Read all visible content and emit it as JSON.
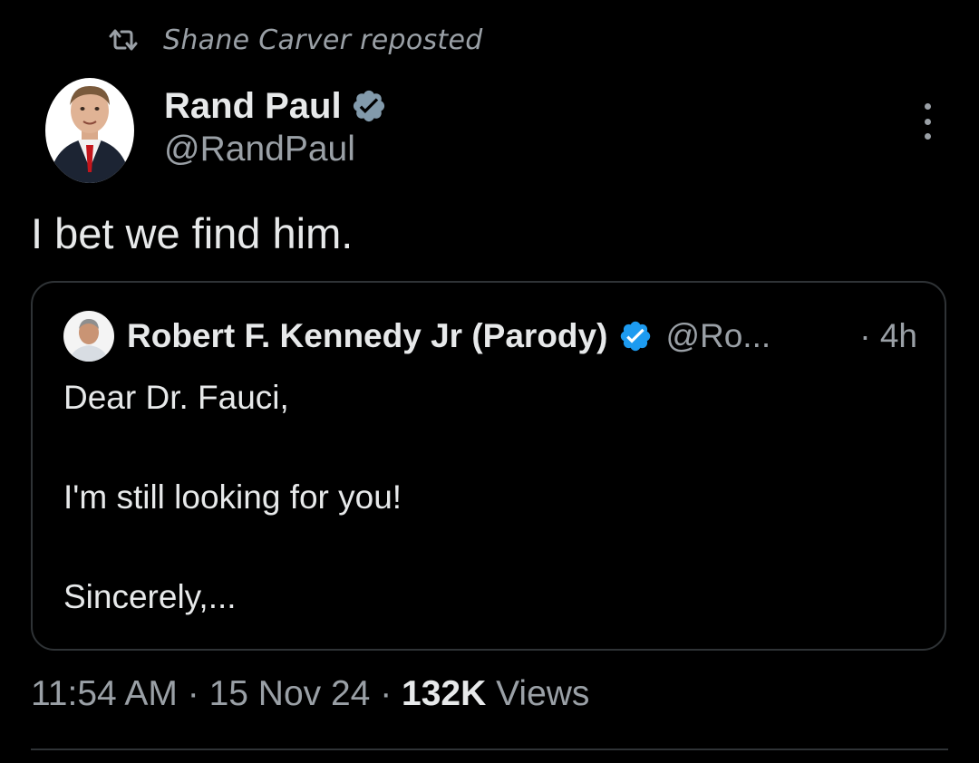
{
  "repost": {
    "icon": "repost-icon",
    "text": "Shane Carver reposted"
  },
  "tweet": {
    "author_name": "Rand Paul",
    "author_handle": "@RandPaul",
    "verified_badge": "verified-gray-badge",
    "text": "I bet we find him.",
    "more_icon": "more-vertical-icon"
  },
  "quote": {
    "author_name": "Robert F. Kennedy Jr (Parody)",
    "verified_badge": "verified-blue-badge",
    "author_handle": "@Ro...",
    "time": "· 4h",
    "line1": "Dear Dr. Fauci,",
    "line2": "I'm still looking for you!",
    "line3": "Sincerely,..."
  },
  "meta": {
    "time": "11:54 AM",
    "sep1": " · ",
    "date": "15 Nov 24",
    "sep2": " · ",
    "views_count": "132K",
    "views_label": " Views"
  },
  "colors": {
    "background": "#000000",
    "primary_text": "#e7e9ea",
    "secondary_text": "#9aa0a6",
    "verified_blue": "#1d9bf0",
    "border": "#2f3336"
  }
}
